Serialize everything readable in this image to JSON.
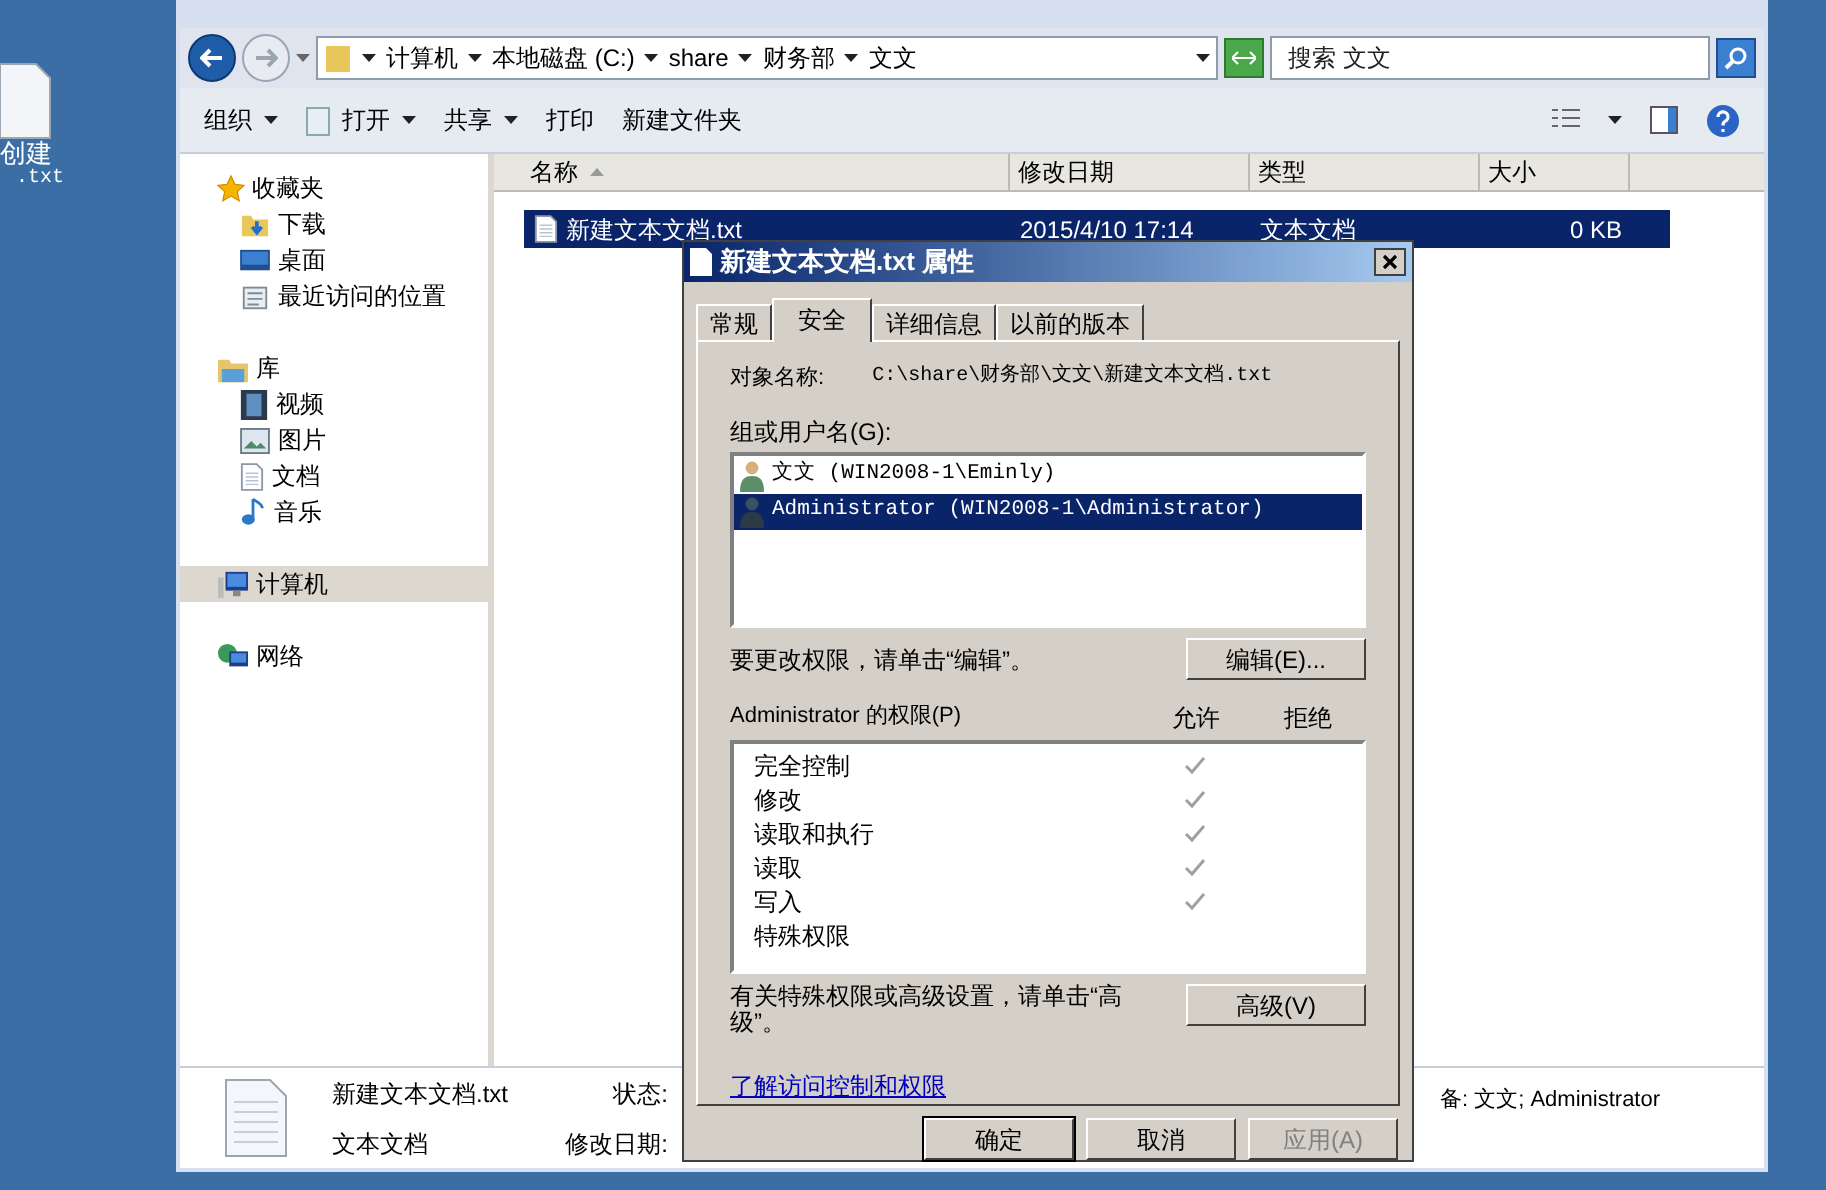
{
  "desktop_icon": {
    "lines": [
      "创建",
      ".txt"
    ]
  },
  "explorer": {
    "breadcrumbs": [
      "计算机",
      "本地磁盘 (C:)",
      "share",
      "财务部",
      "文文"
    ],
    "search": {
      "placeholder": "搜索 文文"
    },
    "toolbar": [
      {
        "label": "组织",
        "has_menu": true
      },
      {
        "label": "打开",
        "has_menu": true
      },
      {
        "label": "共享",
        "has_menu": true
      },
      {
        "label": "打印",
        "has_menu": false
      },
      {
        "label": "新建文件夹",
        "has_menu": false
      }
    ],
    "nav": [
      {
        "label": "收藏夹",
        "selected": false,
        "children": [
          {
            "label": "下载",
            "selected": false
          },
          {
            "label": "桌面",
            "selected": false
          },
          {
            "label": "最近访问的位置",
            "selected": false
          }
        ]
      },
      {
        "label": "库",
        "selected": false,
        "children": [
          {
            "label": "视频",
            "selected": false
          },
          {
            "label": "图片",
            "selected": false
          },
          {
            "label": "文档",
            "selected": false
          },
          {
            "label": "音乐",
            "selected": false
          }
        ]
      },
      {
        "label": "计算机",
        "selected": true
      },
      {
        "label": "网络",
        "selected": false
      }
    ],
    "columns": [
      "名称",
      "修改日期",
      "类型",
      "大小"
    ],
    "rows": [
      {
        "cells": [
          "新建文本文档.txt",
          "2015/4/10 17:14",
          "文本文档",
          "0 KB"
        ],
        "selected": true
      }
    ],
    "details": {
      "name": "新建文本文档.txt",
      "type": "文本文档",
      "status_label": "状态:",
      "modified_label": "修改日期:",
      "owner": "备: 文文; Administrator"
    }
  },
  "dialog": {
    "title": "新建文本文档.txt 属性",
    "tabs": [
      {
        "label": "常规",
        "selected": false
      },
      {
        "label": "安全",
        "selected": true
      },
      {
        "label": "详细信息",
        "selected": false
      },
      {
        "label": "以前的版本",
        "selected": false
      }
    ],
    "object_label": "对象名称:",
    "object_path": "C:\\share\\财务部\\文文\\新建文本文档.txt",
    "users_label": "组或用户名(G):",
    "users": [
      {
        "name": "文文 (WIN2008-1\\Eminly)",
        "selected": false
      },
      {
        "name": "Administrator (WIN2008-1\\Administrator)",
        "selected": true
      }
    ],
    "change_hint": "要更改权限，请单击“编辑”。",
    "edit_button": "编辑(E)...",
    "perm_label": "Administrator 的权限(P)",
    "perm_columns": [
      "允许",
      "拒绝"
    ],
    "permissions": [
      {
        "name": "完全控制",
        "allow": true
      },
      {
        "name": "修改",
        "allow": true
      },
      {
        "name": "读取和执行",
        "allow": true
      },
      {
        "name": "读取",
        "allow": true
      },
      {
        "name": "写入",
        "allow": true
      },
      {
        "name": "特殊权限"
      }
    ],
    "advanced_hint": "有关特殊权限或高级设置，请单击“高级”。",
    "advanced_button": "高级(V)",
    "link": "了解访问控制和权限",
    "buttons": [
      {
        "label": "确定",
        "disabled": false,
        "default": true
      },
      {
        "label": "取消",
        "disabled": false,
        "default": false
      },
      {
        "label": "应用(A)",
        "disabled": true,
        "default": false
      }
    ]
  }
}
